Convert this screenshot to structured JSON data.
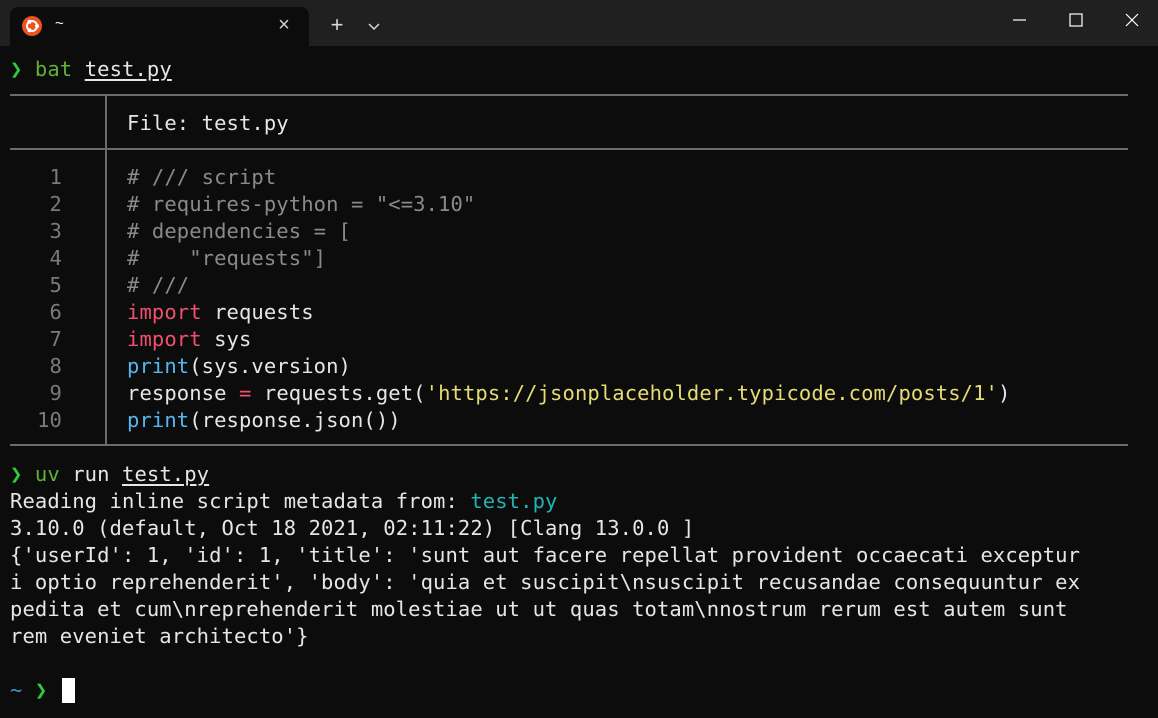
{
  "window": {
    "tab_title": "~",
    "icons": [
      "ubuntu-icon",
      "close-icon",
      "plus-icon",
      "chevron-down-icon",
      "minimize-icon",
      "maximize-icon",
      "close-icon"
    ]
  },
  "terminal": {
    "prompt_symbol": "❯",
    "cmd1": {
      "program": "bat",
      "arg": "test.py"
    },
    "bat_header": "File: test.py",
    "code": [
      {
        "n": "1",
        "parts": [
          {
            "t": "# /// script",
            "c": "gray"
          }
        ]
      },
      {
        "n": "2",
        "parts": [
          {
            "t": "# requires-python = \"<=3.10\"",
            "c": "gray"
          }
        ]
      },
      {
        "n": "3",
        "parts": [
          {
            "t": "# dependencies = [",
            "c": "gray"
          }
        ]
      },
      {
        "n": "4",
        "parts": [
          {
            "t": "#    \"requests\"]",
            "c": "gray"
          }
        ]
      },
      {
        "n": "5",
        "parts": [
          {
            "t": "# ///",
            "c": "gray"
          }
        ]
      },
      {
        "n": "6",
        "parts": [
          {
            "t": "import",
            "c": "red"
          },
          {
            "t": " requests",
            "c": "white"
          }
        ]
      },
      {
        "n": "7",
        "parts": [
          {
            "t": "import",
            "c": "red"
          },
          {
            "t": " sys",
            "c": "white"
          }
        ]
      },
      {
        "n": "8",
        "parts": [
          {
            "t": "print",
            "c": "fnblue"
          },
          {
            "t": "(sys.version)",
            "c": "white"
          }
        ]
      },
      {
        "n": "9",
        "parts": [
          {
            "t": "response ",
            "c": "white"
          },
          {
            "t": "=",
            "c": "red"
          },
          {
            "t": " requests.get(",
            "c": "white"
          },
          {
            "t": "'https://jsonplaceholder.typicode.com/posts/1'",
            "c": "yellow"
          },
          {
            "t": ")",
            "c": "white"
          }
        ]
      },
      {
        "n": "10",
        "parts": [
          {
            "t": "print",
            "c": "fnblue"
          },
          {
            "t": "(response.json())",
            "c": "white"
          }
        ]
      }
    ],
    "cmd2": {
      "program": "uv",
      "rest": " run ",
      "arg": "test.py"
    },
    "reading_prefix": "Reading inline script metadata from: ",
    "reading_file": "test.py",
    "output_lines": [
      "3.10.0 (default, Oct 18 2021, 02:11:22) [Clang 13.0.0 ]",
      "{'userId': 1, 'id': 1, 'title': 'sunt aut facere repellat provident occaecati exceptur",
      "i optio reprehenderit', 'body': 'quia et suscipit\\nsuscipit recusandae consequuntur ex",
      "pedita et cum\\nreprehenderit molestiae ut ut quas totam\\nnostrum rerum est autem sunt",
      "rem eveniet architecto'}"
    ],
    "final_prompt_dir": "~",
    "colors": {
      "background": "#0c0c0c",
      "prompt_green": "#2ecc40",
      "keyword_red": "#f0506e",
      "function_blue": "#56b6f0",
      "string_yellow": "#e6db74",
      "comment_gray": "#8a8a8a",
      "path_cyan": "#22b3b5"
    }
  }
}
